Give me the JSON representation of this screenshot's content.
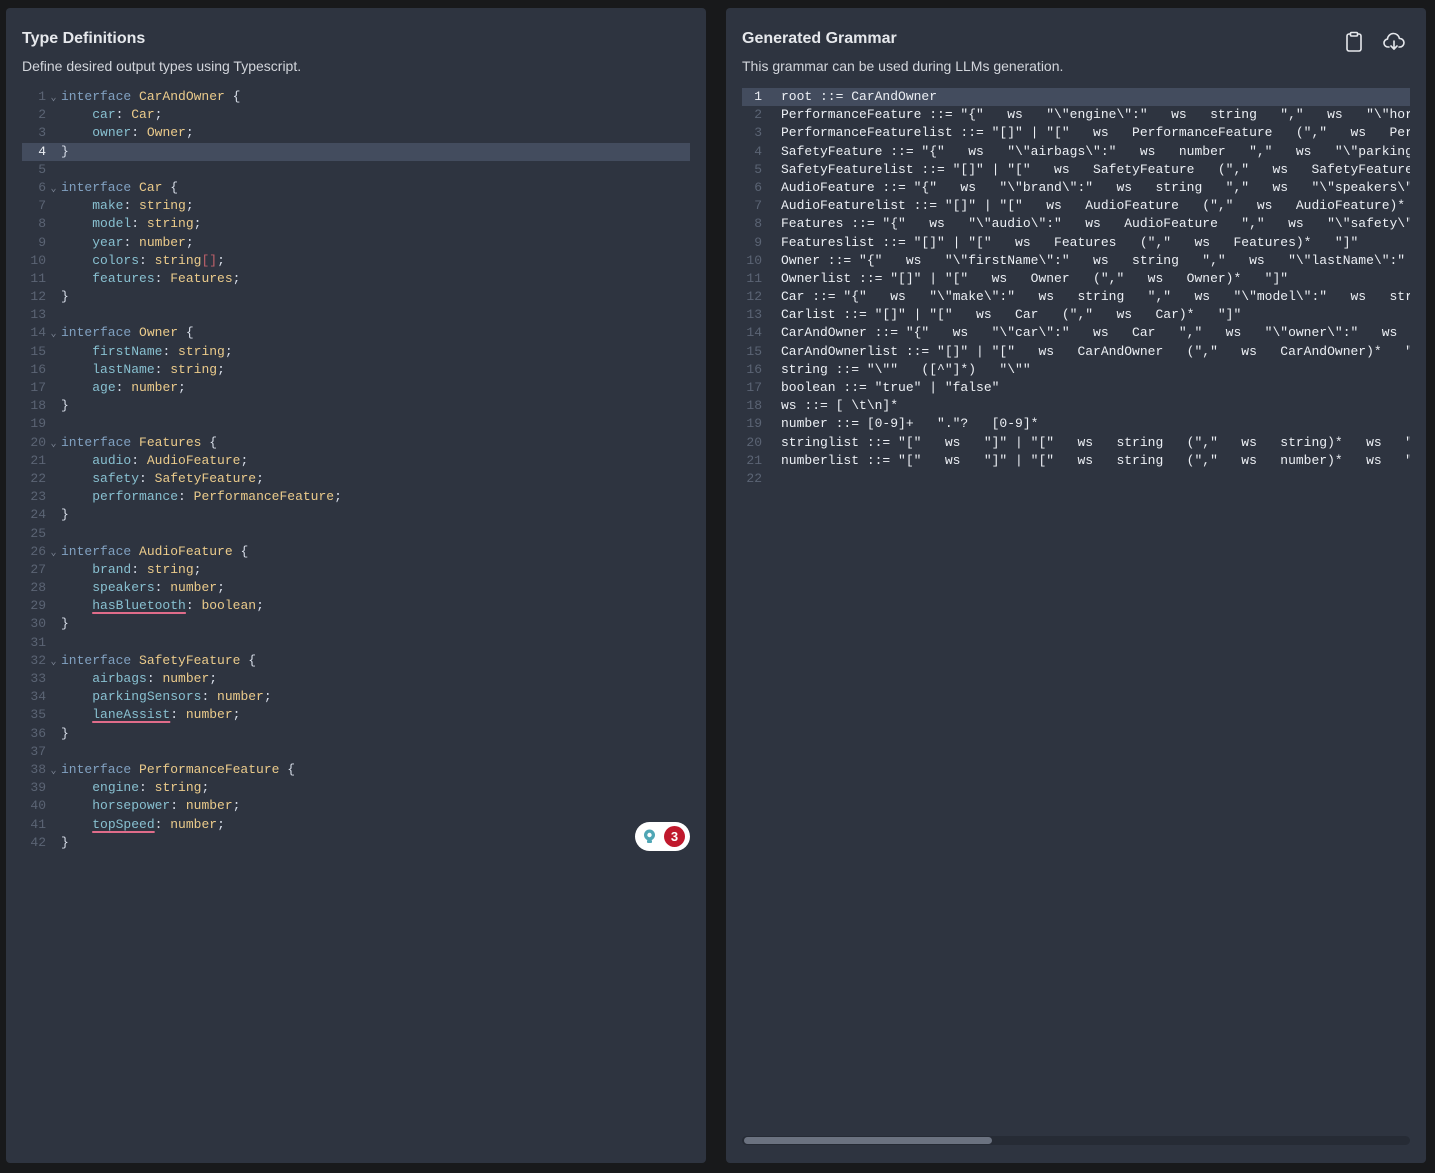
{
  "left_panel": {
    "title": "Type Definitions",
    "subtitle": "Define desired output types using Typescript.",
    "active_line": 4,
    "diagnostics_count": "3",
    "lines": [
      {
        "n": "1",
        "fold": true,
        "tokens": [
          [
            "kw",
            "interface "
          ],
          [
            "ty",
            "CarAndOwner"
          ],
          [
            "pn",
            " {"
          ]
        ]
      },
      {
        "n": "2",
        "tokens": [
          [
            "pn",
            "    "
          ],
          [
            "pr",
            "car"
          ],
          [
            "pn",
            ": "
          ],
          [
            "ty",
            "Car"
          ],
          [
            "pn",
            ";"
          ]
        ]
      },
      {
        "n": "3",
        "tokens": [
          [
            "pn",
            "    "
          ],
          [
            "pr",
            "owner"
          ],
          [
            "pn",
            ": "
          ],
          [
            "ty",
            "Owner"
          ],
          [
            "pn",
            ";"
          ]
        ]
      },
      {
        "n": "4",
        "tokens": [
          [
            "pn",
            "}"
          ]
        ]
      },
      {
        "n": "5",
        "tokens": []
      },
      {
        "n": "6",
        "fold": true,
        "tokens": [
          [
            "kw",
            "interface "
          ],
          [
            "ty",
            "Car"
          ],
          [
            "pn",
            " {"
          ]
        ]
      },
      {
        "n": "7",
        "tokens": [
          [
            "pn",
            "    "
          ],
          [
            "pr",
            "make"
          ],
          [
            "pn",
            ": "
          ],
          [
            "ty",
            "string"
          ],
          [
            "pn",
            ";"
          ]
        ]
      },
      {
        "n": "8",
        "tokens": [
          [
            "pn",
            "    "
          ],
          [
            "pr",
            "model"
          ],
          [
            "pn",
            ": "
          ],
          [
            "ty",
            "string"
          ],
          [
            "pn",
            ";"
          ]
        ]
      },
      {
        "n": "9",
        "tokens": [
          [
            "pn",
            "    "
          ],
          [
            "pr",
            "year"
          ],
          [
            "pn",
            ": "
          ],
          [
            "ty",
            "number"
          ],
          [
            "pn",
            ";"
          ]
        ]
      },
      {
        "n": "10",
        "tokens": [
          [
            "pn",
            "    "
          ],
          [
            "pr",
            "colors"
          ],
          [
            "pn",
            ": "
          ],
          [
            "ty",
            "string"
          ],
          [
            "err",
            "[]"
          ],
          [
            "pn",
            ";"
          ]
        ]
      },
      {
        "n": "11",
        "tokens": [
          [
            "pn",
            "    "
          ],
          [
            "pr",
            "features"
          ],
          [
            "pn",
            ": "
          ],
          [
            "ty",
            "Features"
          ],
          [
            "pn",
            ";"
          ]
        ]
      },
      {
        "n": "12",
        "tokens": [
          [
            "pn",
            "}"
          ]
        ]
      },
      {
        "n": "13",
        "tokens": []
      },
      {
        "n": "14",
        "fold": true,
        "tokens": [
          [
            "kw",
            "interface "
          ],
          [
            "ty",
            "Owner"
          ],
          [
            "pn",
            " {"
          ]
        ]
      },
      {
        "n": "15",
        "tokens": [
          [
            "pn",
            "    "
          ],
          [
            "pr",
            "firstName"
          ],
          [
            "pn",
            ": "
          ],
          [
            "ty",
            "string"
          ],
          [
            "pn",
            ";"
          ]
        ]
      },
      {
        "n": "16",
        "tokens": [
          [
            "pn",
            "    "
          ],
          [
            "pr",
            "lastName"
          ],
          [
            "pn",
            ": "
          ],
          [
            "ty",
            "string"
          ],
          [
            "pn",
            ";"
          ]
        ]
      },
      {
        "n": "17",
        "tokens": [
          [
            "pn",
            "    "
          ],
          [
            "pr",
            "age"
          ],
          [
            "pn",
            ": "
          ],
          [
            "ty",
            "number"
          ],
          [
            "pn",
            ";"
          ]
        ]
      },
      {
        "n": "18",
        "tokens": [
          [
            "pn",
            "}"
          ]
        ]
      },
      {
        "n": "19",
        "tokens": []
      },
      {
        "n": "20",
        "fold": true,
        "tokens": [
          [
            "kw",
            "interface "
          ],
          [
            "ty",
            "Features"
          ],
          [
            "pn",
            " {"
          ]
        ]
      },
      {
        "n": "21",
        "tokens": [
          [
            "pn",
            "    "
          ],
          [
            "pr",
            "audio"
          ],
          [
            "pn",
            ": "
          ],
          [
            "ty",
            "AudioFeature"
          ],
          [
            "pn",
            ";"
          ]
        ]
      },
      {
        "n": "22",
        "tokens": [
          [
            "pn",
            "    "
          ],
          [
            "pr",
            "safety"
          ],
          [
            "pn",
            ": "
          ],
          [
            "ty",
            "SafetyFeature"
          ],
          [
            "pn",
            ";"
          ]
        ]
      },
      {
        "n": "23",
        "tokens": [
          [
            "pn",
            "    "
          ],
          [
            "pr",
            "performance"
          ],
          [
            "pn",
            ": "
          ],
          [
            "ty",
            "PerformanceFeature"
          ],
          [
            "pn",
            ";"
          ]
        ]
      },
      {
        "n": "24",
        "tokens": [
          [
            "pn",
            "}"
          ]
        ]
      },
      {
        "n": "25",
        "tokens": []
      },
      {
        "n": "26",
        "fold": true,
        "tokens": [
          [
            "kw",
            "interface "
          ],
          [
            "ty",
            "AudioFeature"
          ],
          [
            "pn",
            " {"
          ]
        ]
      },
      {
        "n": "27",
        "tokens": [
          [
            "pn",
            "    "
          ],
          [
            "pr",
            "brand"
          ],
          [
            "pn",
            ": "
          ],
          [
            "ty",
            "string"
          ],
          [
            "pn",
            ";"
          ]
        ]
      },
      {
        "n": "28",
        "tokens": [
          [
            "pn",
            "    "
          ],
          [
            "pr",
            "speakers"
          ],
          [
            "pn",
            ": "
          ],
          [
            "ty",
            "number"
          ],
          [
            "pn",
            ";"
          ]
        ]
      },
      {
        "n": "29",
        "tokens": [
          [
            "pn",
            "    "
          ],
          [
            "prw",
            "hasBluetooth"
          ],
          [
            "pn",
            ": "
          ],
          [
            "ty",
            "boolean"
          ],
          [
            "pn",
            ";"
          ]
        ]
      },
      {
        "n": "30",
        "tokens": [
          [
            "pn",
            "}"
          ]
        ]
      },
      {
        "n": "31",
        "tokens": []
      },
      {
        "n": "32",
        "fold": true,
        "tokens": [
          [
            "kw",
            "interface "
          ],
          [
            "ty",
            "SafetyFeature"
          ],
          [
            "pn",
            " {"
          ]
        ]
      },
      {
        "n": "33",
        "tokens": [
          [
            "pn",
            "    "
          ],
          [
            "pr",
            "airbags"
          ],
          [
            "pn",
            ": "
          ],
          [
            "ty",
            "number"
          ],
          [
            "pn",
            ";"
          ]
        ]
      },
      {
        "n": "34",
        "tokens": [
          [
            "pn",
            "    "
          ],
          [
            "pr",
            "parkingSensors"
          ],
          [
            "pn",
            ": "
          ],
          [
            "ty",
            "number"
          ],
          [
            "pn",
            ";"
          ]
        ]
      },
      {
        "n": "35",
        "tokens": [
          [
            "pn",
            "    "
          ],
          [
            "prw",
            "laneAssist"
          ],
          [
            "pn",
            ": "
          ],
          [
            "ty",
            "number"
          ],
          [
            "pn",
            ";"
          ]
        ]
      },
      {
        "n": "36",
        "tokens": [
          [
            "pn",
            "}"
          ]
        ]
      },
      {
        "n": "37",
        "tokens": []
      },
      {
        "n": "38",
        "fold": true,
        "tokens": [
          [
            "kw",
            "interface "
          ],
          [
            "ty",
            "PerformanceFeature"
          ],
          [
            "pn",
            " {"
          ]
        ]
      },
      {
        "n": "39",
        "tokens": [
          [
            "pn",
            "    "
          ],
          [
            "pr",
            "engine"
          ],
          [
            "pn",
            ": "
          ],
          [
            "ty",
            "string"
          ],
          [
            "pn",
            ";"
          ]
        ]
      },
      {
        "n": "40",
        "tokens": [
          [
            "pn",
            "    "
          ],
          [
            "pr",
            "horsepower"
          ],
          [
            "pn",
            ": "
          ],
          [
            "ty",
            "number"
          ],
          [
            "pn",
            ";"
          ]
        ]
      },
      {
        "n": "41",
        "tokens": [
          [
            "pn",
            "    "
          ],
          [
            "prw",
            "topSpeed"
          ],
          [
            "pn",
            ": "
          ],
          [
            "ty",
            "number"
          ],
          [
            "pn",
            ";"
          ]
        ]
      },
      {
        "n": "42",
        "tokens": [
          [
            "pn",
            "}"
          ]
        ]
      }
    ]
  },
  "right_panel": {
    "title": "Generated Grammar",
    "subtitle": "This grammar can be used during LLMs generation.",
    "copy_icon": "clipboard-icon",
    "download_icon": "cloud-download-icon",
    "active_line": 1,
    "lines": [
      "root ::= CarAndOwner",
      "PerformanceFeature ::= \"{\"   ws   \"\\\"engine\\\":\"   ws   string   \",\"   ws   \"\\\"horsepower\\\":\"",
      "PerformanceFeaturelist ::= \"[]\" | \"[\"   ws   PerformanceFeature   (\",\"   ws   PerformanceFeature)*",
      "SafetyFeature ::= \"{\"   ws   \"\\\"airbags\\\":\"   ws   number   \",\"   ws   \"\\\"parkingSensors\\\":\"",
      "SafetyFeaturelist ::= \"[]\" | \"[\"   ws   SafetyFeature   (\",\"   ws   SafetyFeature)*",
      "AudioFeature ::= \"{\"   ws   \"\\\"brand\\\":\"   ws   string   \",\"   ws   \"\\\"speakers\\\":\"",
      "AudioFeaturelist ::= \"[]\" | \"[\"   ws   AudioFeature   (\",\"   ws   AudioFeature)*   \"]\"",
      "Features ::= \"{\"   ws   \"\\\"audio\\\":\"   ws   AudioFeature   \",\"   ws   \"\\\"safety\\\":\"",
      "Featureslist ::= \"[]\" | \"[\"   ws   Features   (\",\"   ws   Features)*   \"]\"",
      "Owner ::= \"{\"   ws   \"\\\"firstName\\\":\"   ws   string   \",\"   ws   \"\\\"lastName\\\":\"",
      "Ownerlist ::= \"[]\" | \"[\"   ws   Owner   (\",\"   ws   Owner)*   \"]\"",
      "Car ::= \"{\"   ws   \"\\\"make\\\":\"   ws   string   \",\"   ws   \"\\\"model\\\":\"   ws   string",
      "Carlist ::= \"[]\" | \"[\"   ws   Car   (\",\"   ws   Car)*   \"]\"",
      "CarAndOwner ::= \"{\"   ws   \"\\\"car\\\":\"   ws   Car   \",\"   ws   \"\\\"owner\\\":\"   ws   Owner",
      "CarAndOwnerlist ::= \"[]\" | \"[\"   ws   CarAndOwner   (\",\"   ws   CarAndOwner)*   \"]\"",
      "string ::= \"\\\"\"   ([^\"]*)   \"\\\"\"",
      "boolean ::= \"true\" | \"false\"",
      "ws ::= [ \\t\\n]*",
      "number ::= [0-9]+   \".\"?   [0-9]*",
      "stringlist ::= \"[\"   ws   \"]\" | \"[\"   ws   string   (\",\"   ws   string)*   ws   \"]\"",
      "numberlist ::= \"[\"   ws   \"]\" | \"[\"   ws   string   (\",\"   ws   number)*   ws   \"]\"",
      ""
    ]
  }
}
